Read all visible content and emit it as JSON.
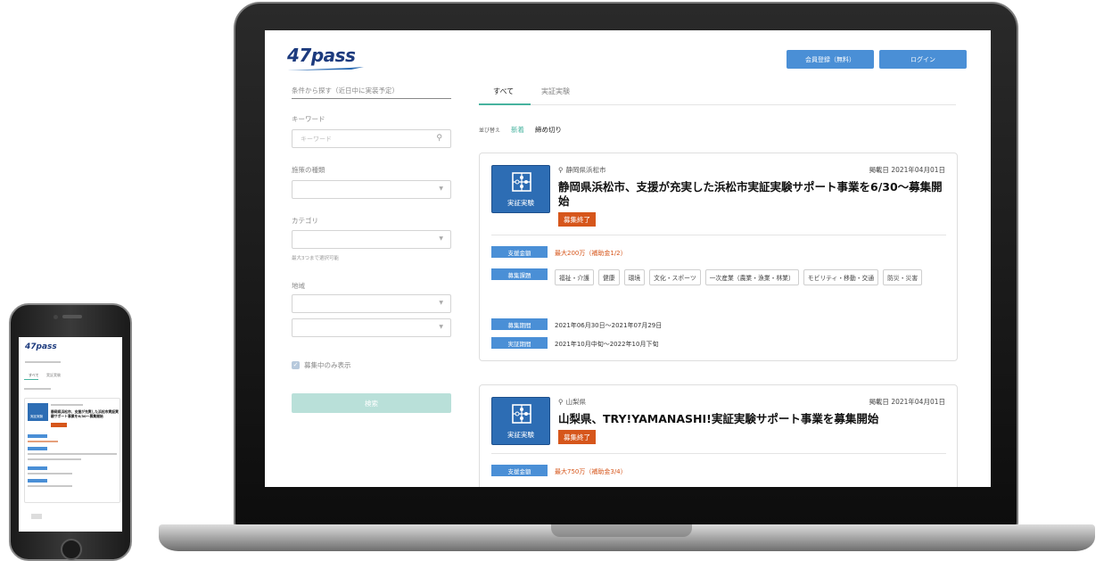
{
  "header": {
    "logo_text": "47pass",
    "register_label": "会員登録（無料）",
    "login_label": "ログイン"
  },
  "sidebar": {
    "title": "条件から探す（近日中に実装予定）",
    "keyword_label": "キーワード",
    "keyword_placeholder": "キーワード",
    "measure_label": "施策の種類",
    "category_label": "カテゴリ",
    "category_note": "最大3つまで選択可能",
    "region_label": "地域",
    "recruiting_only_label": "募集中のみ表示",
    "recruiting_only_checked": true,
    "search_label": "検索"
  },
  "tabs": [
    {
      "label": "すべて",
      "active": true
    },
    {
      "label": "実証実験",
      "active": false
    }
  ],
  "sort": {
    "label": "並び替え",
    "new_label": "新着",
    "deadline_label": "締め切り"
  },
  "cards": [
    {
      "type_label": "実証実験",
      "location": "静岡県浜松市",
      "posted": "掲載日 2021年04月01日",
      "title": "静岡県浜松市、支援が充実した浜松市実証実験サポート事業を6/30〜募集開始",
      "status": "募集終了",
      "support_label": "支援金額",
      "support_value": "最大200万（補助金1/2）",
      "topics_label": "募集課題",
      "topics": [
        "福祉・介護",
        "健康",
        "環境",
        "文化・スポーツ",
        "一次産業（農業・漁業・林業）",
        "モビリティ・移動・交通",
        "防災・災害"
      ],
      "period_label": "募集期間",
      "period_value": "2021年06月30日〜2021年07月29日",
      "exp_label": "実証期間",
      "exp_value": "2021年10月中旬〜2022年10月下旬"
    },
    {
      "type_label": "実証実験",
      "location": "山梨県",
      "posted": "掲載日 2021年04月01日",
      "title": "山梨県、TRY!YAMANASHI!実証実験サポート事業を募集開始",
      "status": "募集終了",
      "support_label": "支援金額",
      "support_value": "最大750万（補助金3/4）"
    }
  ],
  "mobile": {
    "logo_text": "47pass",
    "tab_all": "すべて",
    "tab_exp": "実証実験",
    "card_icon_label": "実証実験",
    "card_title": "静岡県浜松市、支援が充実した浜松市実証実験サポート事業を6/30〜募集開始"
  },
  "colors": {
    "primary_blue": "#4a8fd6",
    "icon_blue": "#2d6db4",
    "accent_teal": "#47b39f",
    "status_orange": "#d6561b",
    "logo_navy": "#1d3b7e"
  }
}
